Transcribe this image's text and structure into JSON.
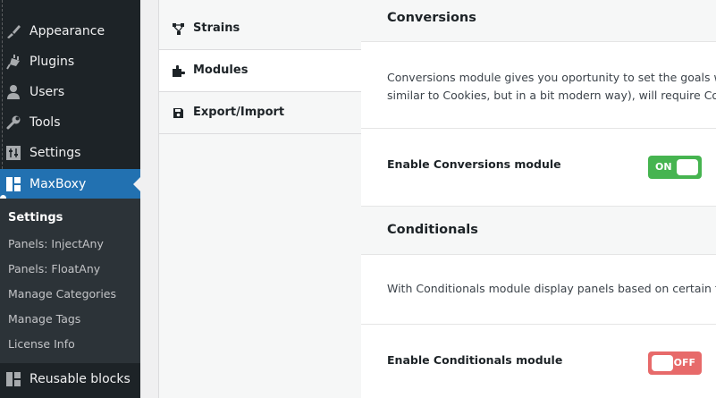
{
  "sidebar": {
    "items": [
      {
        "label": "Appearance",
        "icon": "paintbrush-icon"
      },
      {
        "label": "Plugins",
        "icon": "plugin-icon"
      },
      {
        "label": "Users",
        "icon": "user-icon"
      },
      {
        "label": "Tools",
        "icon": "wrench-icon"
      },
      {
        "label": "Settings",
        "icon": "settings-sliders-icon"
      },
      {
        "label": "MaxBoxy",
        "icon": "blocks-icon"
      }
    ],
    "submenu": [
      "Settings",
      "Panels: InjectAny",
      "Panels: FloatAny",
      "Manage Categories",
      "Manage Tags",
      "License Info"
    ],
    "bottom_item": {
      "label": "Reusable blocks",
      "icon": "blocks-icon"
    }
  },
  "tabs": [
    {
      "label": "Strains",
      "icon": "strains-icon"
    },
    {
      "label": "Modules",
      "icon": "puzzle-icon"
    },
    {
      "label": "Export/Import",
      "icon": "save-icon"
    }
  ],
  "sections": {
    "conversions": {
      "title": "Conversions",
      "description_line1": "Conversions module gives you oportunity to set the goals with",
      "description_line2": "similar to Cookies, but in a bit modern way), will require Conver",
      "option_label": "Enable Conversions module",
      "toggle": "ON"
    },
    "conditionals": {
      "title": "Conditionals",
      "description": "With Conditionals module display panels based on certain trigg",
      "option_label": "Enable Conditionals module",
      "toggle": "OFF"
    }
  },
  "colors": {
    "sidebar_bg": "#1d2327",
    "submenu_bg": "#2c3338",
    "accent": "#2271b1",
    "toggle_on": "#46b450",
    "toggle_off": "#e76a6a"
  }
}
